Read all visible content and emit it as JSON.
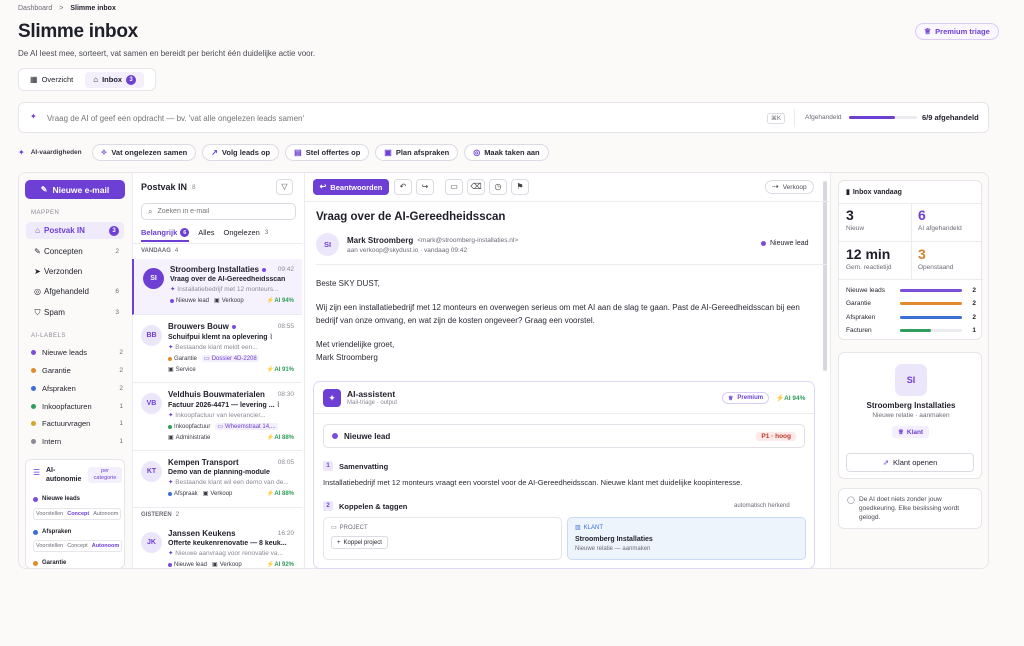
{
  "breadcrumb": {
    "parent": "Dashboard",
    "sep": ">",
    "current": "Slimme inbox"
  },
  "header": {
    "title": "Slimme inbox",
    "subtitle": "De AI leest mee, sorteert, vat samen en bereidt per bericht één duidelijke actie voor.",
    "premium_label": "Premium triage"
  },
  "tabs": [
    {
      "label": "Overzicht",
      "icon": "grid-icon"
    },
    {
      "label": "Inbox",
      "icon": "inbox-icon",
      "count": "3"
    }
  ],
  "prompt": {
    "placeholder": "Vraag de AI of geef een opdracht — bv. 'vat alle ongelezen leads samen'",
    "kbd": "⌘K",
    "progress_label": "Afgehandeld",
    "progress_value": 0.67,
    "progress_text": "6/9 afgehandeld"
  },
  "skills": {
    "label": "AI-vaardigheden",
    "items": [
      "Vat ongelezen samen",
      "Volg leads op",
      "Stel offertes op",
      "Plan afspraken",
      "Maak taken aan"
    ]
  },
  "sidebar": {
    "compose": "Nieuwe e-mail",
    "folders_title": "MAPPEN",
    "folders": [
      {
        "label": "Postvak IN",
        "count": "3",
        "icon": "inbox-icon"
      },
      {
        "label": "Concepten",
        "count": "2",
        "icon": "pencil-icon"
      },
      {
        "label": "Verzonden",
        "count": "",
        "icon": "send-icon"
      },
      {
        "label": "Afgehandeld",
        "count": "6",
        "icon": "check-circle-icon"
      },
      {
        "label": "Spam",
        "count": "3",
        "icon": "shield-icon"
      }
    ],
    "labels_title": "AI-LABELS",
    "labels": [
      {
        "label": "Nieuwe leads",
        "count": "2",
        "color": "#7c4ddb"
      },
      {
        "label": "Garantie",
        "count": "2",
        "color": "#e08a2c"
      },
      {
        "label": "Afspraken",
        "count": "2",
        "color": "#3b6fd4"
      },
      {
        "label": "Inkoopfacturen",
        "count": "1",
        "color": "#2f9e5a"
      },
      {
        "label": "Factuurvragen",
        "count": "1",
        "color": "#d4a62c"
      },
      {
        "label": "Intern",
        "count": "1",
        "color": "#8a8a96"
      }
    ],
    "autonomy": {
      "title": "AI-autonomie",
      "badge": "per categorie",
      "cats": [
        {
          "label": "Nieuwe leads",
          "color": "#7c4ddb"
        },
        {
          "label": "Afspraken",
          "color": "#3b6fd4"
        },
        {
          "label": "Garantie",
          "color": "#e08a2c"
        }
      ],
      "opts": [
        "Voorstellen",
        "Concept",
        "Autonoom"
      ]
    }
  },
  "list": {
    "title": "Postvak IN",
    "count": "8",
    "search_placeholder": "Zoeken in e-mail",
    "tabs": [
      {
        "label": "Belangrijk",
        "count": "6"
      },
      {
        "label": "Alles",
        "count": ""
      },
      {
        "label": "Ongelezen",
        "count": "3"
      }
    ],
    "groups": [
      {
        "label": "VANDAAG",
        "count": "4"
      },
      {
        "label": "GISTEREN",
        "count": "2"
      }
    ],
    "mails": [
      {
        "initials": "SI",
        "name": "Stroomberg Installaties",
        "time": "09:42",
        "subject": "Vraag over de AI-Gereedheidsscan",
        "preview": "Installatiebedrijf met 12 monteurs...",
        "tag1": "Nieuwe lead",
        "tag1c": "#7c4ddb",
        "tag2": "Verkoop",
        "tag3": "",
        "ai": "AI 94%"
      },
      {
        "initials": "BB",
        "name": "Brouwers Bouw",
        "time": "08:55",
        "subject": "Schuifpui klemt na oplevering",
        "preview": "Bestaande klant meldt een...",
        "tag1": "Garantie",
        "tag1c": "#e08a2c",
        "tag2": "",
        "tag3": "Dossier 4D-2208",
        "tag4": "Service",
        "ai": "AI 91%"
      },
      {
        "initials": "VB",
        "name": "Veldhuis Bouwmaterialen",
        "time": "08:30",
        "subject": "Factuur 2026-4471 — levering ...",
        "preview": "Inkoopfactuur van leverancier...",
        "tag1": "Inkoopfactuur",
        "tag1c": "#2f9e5a",
        "tag2": "",
        "tag3": "Wheemstraat 14,...",
        "tag4": "Administratie",
        "ai": "AI 88%"
      },
      {
        "initials": "KT",
        "name": "Kempen Transport",
        "time": "08:05",
        "subject": "Demo van de planning-module",
        "preview": "Bestaande klant wil een demo van de...",
        "tag1": "Afspraak",
        "tag1c": "#3b6fd4",
        "tag2": "Verkoop",
        "tag3": "",
        "ai": "AI 88%"
      },
      {
        "initials": "JK",
        "name": "Janssen Keukens",
        "time": "16:20",
        "subject": "Offerte keukenrenovatie — 8 keuk...",
        "preview": "Nieuwe aanvraag voor renovatie va...",
        "tag1": "Nieuwe lead",
        "tag1c": "#7c4ddb",
        "tag2": "Verkoop",
        "tag3": "",
        "ai": "AI 92%"
      }
    ]
  },
  "reader": {
    "reply": "Beantwoorden",
    "dept": "Verkoop",
    "subject": "Vraag over de AI-Gereedheidsscan",
    "initials": "SI",
    "sender": "Mark Stroomberg",
    "email": "<mark@stroomberg-installaties.nl>",
    "to": "aan verkoop@skydust.io · vandaag 09:42",
    "status": "Nieuwe lead",
    "body": [
      "Beste SKY DUST,",
      "Wij zijn een installatiebedrijf met 12 monteurs en overwegen serieus om met AI aan de slag te gaan. Past de AI-Gereedheidsscan bij een bedrijf van onze omvang, en wat zijn de kosten ongeveer? Graag een voorstel.",
      "Met vriendelijke groet,",
      "Mark Stroomberg"
    ],
    "assistant": {
      "title": "AI-assistent",
      "sub": "Mail-triage · output",
      "premium": "Premium",
      "score": "AI 94%",
      "class_label": "Nieuwe lead",
      "priority": "P1 · hoog",
      "step1_num": "1",
      "step1": "Samenvatting",
      "summary": "Installatiebedrijf met 12 monteurs vraagt een voorstel voor de AI-Gereedheidsscan. Nieuwe klant met duidelijke koopinteresse.",
      "step2_num": "2",
      "step2": "Koppelen & taggen",
      "step2_note": "automatisch herkend",
      "project_label": "PROJECT",
      "project_btn": "Koppel project",
      "client_label": "KLANT",
      "client_name": "Stroomberg Installaties",
      "client_sub": "Nieuwe relatie — aanmaken"
    }
  },
  "right": {
    "today_title": "Inbox vandaag",
    "stats": [
      {
        "value": "3",
        "label": "Nieuw",
        "color": "#1f1f2b"
      },
      {
        "value": "6",
        "label": "AI afgehandeld",
        "color": "#6d3fd4"
      },
      {
        "value": "12 min",
        "label": "Gem. reactietijd",
        "color": "#1f1f2b"
      },
      {
        "value": "3",
        "label": "Openstaand",
        "color": "#d4812c"
      }
    ],
    "bars": [
      {
        "label": "Nieuwe leads",
        "value": "2",
        "frac": 1.0,
        "color": "#7c4ddb"
      },
      {
        "label": "Garantie",
        "value": "2",
        "frac": 1.0,
        "color": "#e08a2c"
      },
      {
        "label": "Afspraken",
        "value": "2",
        "frac": 1.0,
        "color": "#3b6fd4"
      },
      {
        "label": "Facturen",
        "value": "1",
        "frac": 0.5,
        "color": "#2f9e5a"
      }
    ],
    "contact": {
      "initials": "SI",
      "name": "Stroomberg Installaties",
      "sub": "Nieuwe relatie · aanmaken",
      "badge": "Klant",
      "button": "Klant openen"
    },
    "note": "De AI doet niets zonder jouw goedkeuring. Elke beslissing wordt gelogd."
  }
}
